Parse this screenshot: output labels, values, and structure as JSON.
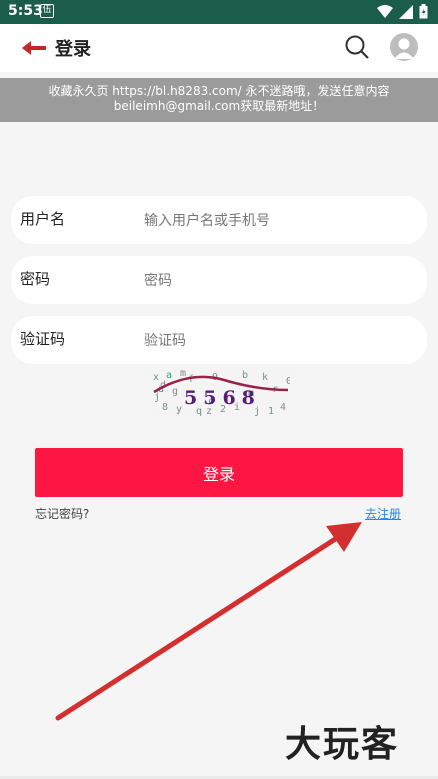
{
  "status_bar": {
    "time": "5:53",
    "notif_glyph": "伍"
  },
  "header": {
    "title": "登录"
  },
  "notice": {
    "line1": "收藏永久页 https://bl.h8283.com/ 永不迷路哦，发送任意内容",
    "line2": "beileimh@gmail.com获取最新地址！"
  },
  "form": {
    "username_label": "用户名",
    "username_placeholder": "输入用户名或手机号",
    "password_label": "密码",
    "password_placeholder": "密码",
    "captcha_label": "验证码",
    "captcha_placeholder": "验证码",
    "captcha_text": "5568",
    "login_label": "登录",
    "forgot_label": "忘记密码?",
    "register_label": "去注册"
  },
  "watermark": "大玩客",
  "colors": {
    "status_bar": "#1a5e4a",
    "accent": "#ff1744",
    "link": "#1e88e5",
    "back_arrow": "#c62828"
  }
}
